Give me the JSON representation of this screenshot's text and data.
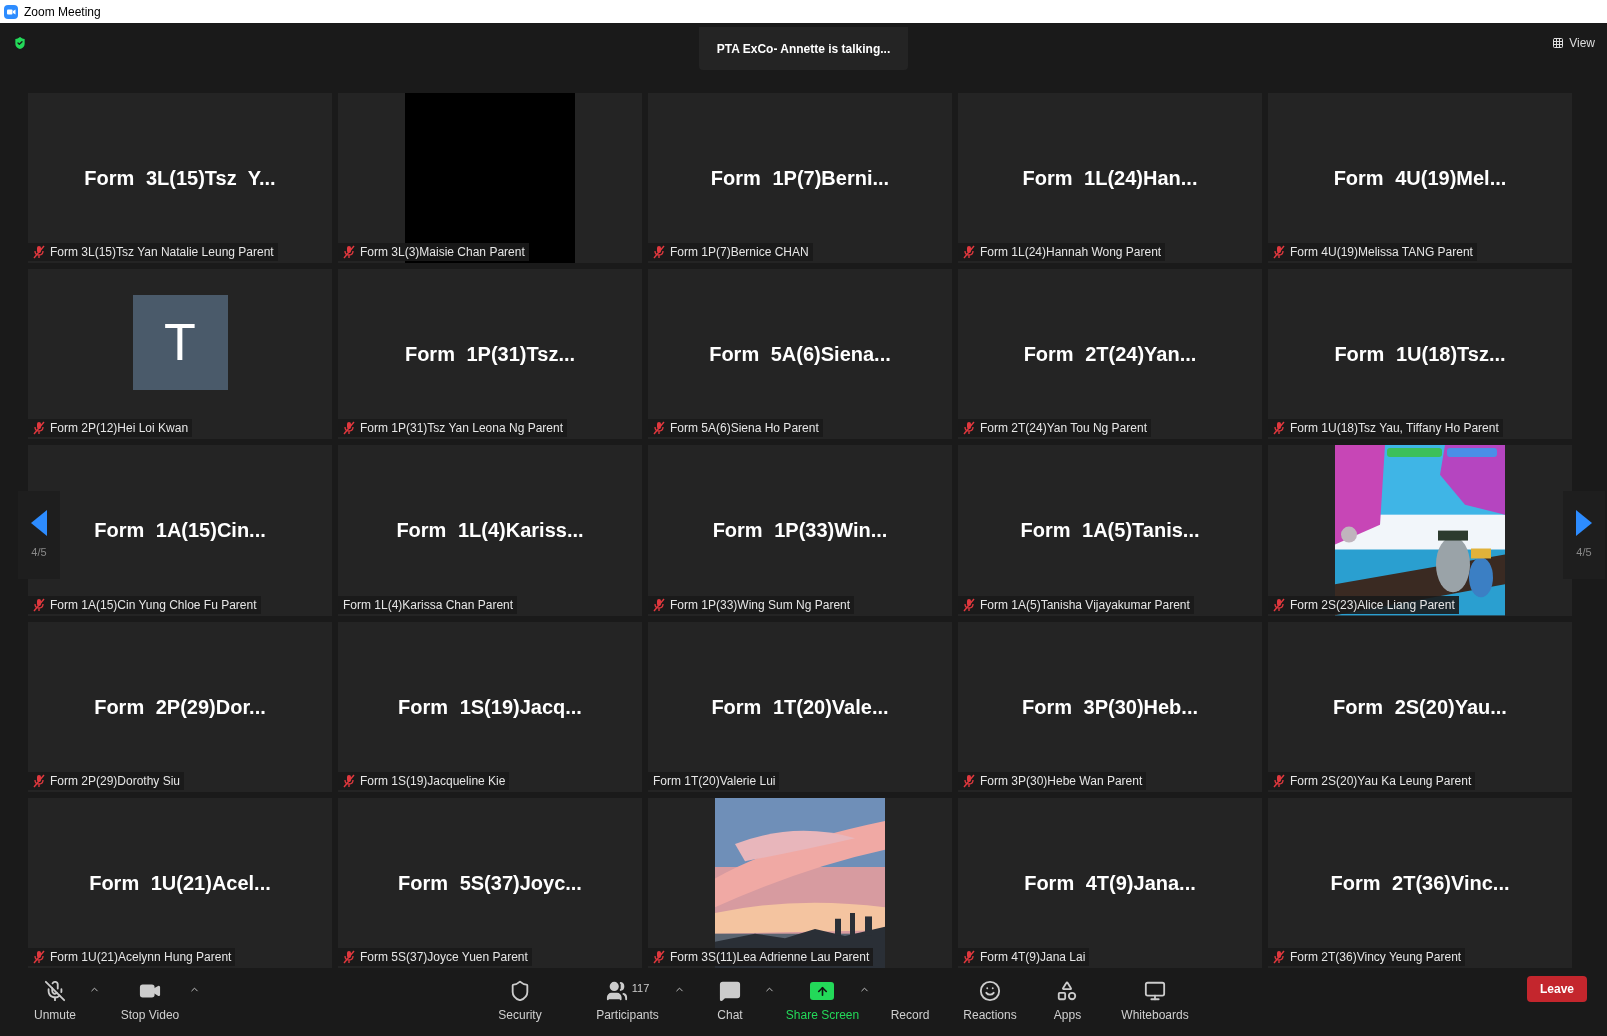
{
  "window": {
    "title": "Zoom Meeting"
  },
  "speaker_banner": "PTA ExCo- Annette is talking...",
  "view_button": "View",
  "pager": {
    "left": "4/5",
    "right": "4/5"
  },
  "tiles": [
    {
      "kind": "name",
      "big_name": "Form 3L(15)Tsz Y...",
      "label": "Form 3L(15)Tsz Yan Natalie Leung Parent",
      "muted": true
    },
    {
      "kind": "black",
      "label": "Form 3L(3)Maisie Chan Parent",
      "muted": true
    },
    {
      "kind": "name",
      "big_name": "Form 1P(7)Berni...",
      "label": "Form 1P(7)Bernice CHAN",
      "muted": true
    },
    {
      "kind": "name",
      "big_name": "Form 1L(24)Han...",
      "label": "Form 1L(24)Hannah Wong Parent",
      "muted": true
    },
    {
      "kind": "name",
      "big_name": "Form 4U(19)Mel...",
      "label": "Form 4U(19)Melissa TANG Parent",
      "muted": true
    },
    {
      "kind": "avatar",
      "initial": "T",
      "label": "Form 2P(12)Hei Loi Kwan",
      "muted": true
    },
    {
      "kind": "name",
      "big_name": "Form 1P(31)Tsz...",
      "label": "Form 1P(31)Tsz Yan Leona Ng Parent",
      "muted": true
    },
    {
      "kind": "name",
      "big_name": "Form 5A(6)Siena...",
      "label": "Form 5A(6)Siena Ho Parent",
      "muted": true
    },
    {
      "kind": "name",
      "big_name": "Form 2T(24)Yan...",
      "label": "Form 2T(24)Yan Tou Ng Parent",
      "muted": true
    },
    {
      "kind": "name",
      "big_name": "Form 1U(18)Tsz...",
      "label": "Form 1U(18)Tsz Yau, Tiffany Ho Parent",
      "muted": true
    },
    {
      "kind": "name",
      "big_name": "Form 1A(15)Cin...",
      "label": "Form 1A(15)Cin Yung Chloe Fu Parent",
      "muted": true
    },
    {
      "kind": "name",
      "big_name": "Form 1L(4)Kariss...",
      "label": "Form 1L(4)Karissa Chan Parent",
      "muted": false
    },
    {
      "kind": "name",
      "big_name": "Form 1P(33)Win...",
      "label": "Form 1P(33)Wing Sum Ng Parent",
      "muted": true
    },
    {
      "kind": "name",
      "big_name": "Form 1A(5)Tanis...",
      "label": "Form 1A(5)Tanisha Vijayakumar Parent",
      "muted": true
    },
    {
      "kind": "picture",
      "label": "Form 2S(23)Alice Liang Parent",
      "muted": true
    },
    {
      "kind": "name",
      "big_name": "Form 2P(29)Dor...",
      "label": "Form 2P(29)Dorothy Siu",
      "muted": true
    },
    {
      "kind": "name",
      "big_name": "Form 1S(19)Jacq...",
      "label": "Form 1S(19)Jacqueline Kie",
      "muted": true
    },
    {
      "kind": "name",
      "big_name": "Form 1T(20)Vale...",
      "label": "Form 1T(20)Valerie Lui",
      "muted": false
    },
    {
      "kind": "name",
      "big_name": "Form 3P(30)Heb...",
      "label": "Form 3P(30)Hebe Wan Parent",
      "muted": true
    },
    {
      "kind": "name",
      "big_name": "Form 2S(20)Yau...",
      "label": "Form 2S(20)Yau Ka Leung Parent",
      "muted": true
    },
    {
      "kind": "name",
      "big_name": "Form 1U(21)Acel...",
      "label": "Form 1U(21)Acelynn Hung Parent",
      "muted": true
    },
    {
      "kind": "name",
      "big_name": "Form 5S(37)Joyc...",
      "label": "Form 5S(37)Joyce Yuen Parent",
      "muted": true
    },
    {
      "kind": "picture",
      "label": "Form 3S(11)Lea Adrienne Lau Parent",
      "muted": true
    },
    {
      "kind": "name",
      "big_name": "Form 4T(9)Jana...",
      "label": "Form 4T(9)Jana Lai",
      "muted": true
    },
    {
      "kind": "name",
      "big_name": "Form 2T(36)Vinc...",
      "label": "Form 2T(36)Vincy Yeung Parent",
      "muted": true
    }
  ],
  "toolbar": [
    {
      "kind": "unmute",
      "label": "Unmute",
      "caret": true
    },
    {
      "kind": "video",
      "label": "Stop Video",
      "caret": true
    },
    {
      "kind": "security",
      "label": "Security",
      "caret": false
    },
    {
      "kind": "participants",
      "label": "Participants",
      "count": "117",
      "caret": true
    },
    {
      "kind": "chat",
      "label": "Chat",
      "caret": true
    },
    {
      "kind": "share",
      "label": "Share Screen",
      "caret": true
    },
    {
      "kind": "record",
      "label": "Record",
      "caret": false
    },
    {
      "kind": "reactions",
      "label": "Reactions",
      "caret": false
    },
    {
      "kind": "apps",
      "label": "Apps",
      "caret": false
    },
    {
      "kind": "whiteboards",
      "label": "Whiteboards",
      "caret": false
    }
  ],
  "leave_button": "Leave"
}
